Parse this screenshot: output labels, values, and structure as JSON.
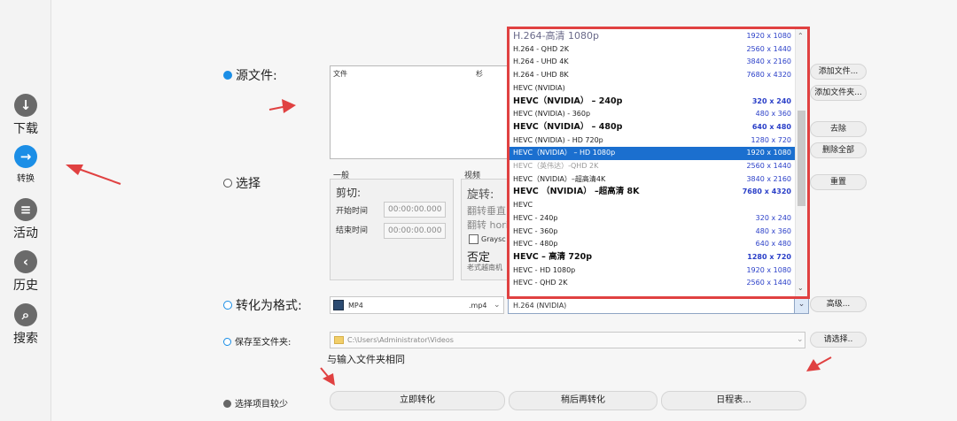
{
  "nav": {
    "items": [
      {
        "label": "下载",
        "icon": "download-icon",
        "glyph": "↓"
      },
      {
        "label": "转换",
        "icon": "convert-icon",
        "glyph": "→",
        "active": true
      },
      {
        "label": "活动",
        "icon": "list-icon",
        "glyph": "≡"
      },
      {
        "label": "历史",
        "icon": "back-icon",
        "glyph": "‹"
      },
      {
        "label": "搜索",
        "icon": "search-icon",
        "glyph": "⌕"
      }
    ]
  },
  "source": {
    "label": "源文件:",
    "file_col": "文件",
    "col2_fragment": "杉"
  },
  "side_buttons": {
    "add_file": "添加文件...",
    "add_folder": "添加文件夹...",
    "remove": "去除",
    "remove_all": "删除全部",
    "reset": "重置"
  },
  "select": {
    "label": "选择",
    "general_title": "一般",
    "cut_title": "剪切:",
    "start_label": "开始时间",
    "start_value": "00:00:00.000",
    "end_label": "结束时间",
    "end_value": "00:00:00.000",
    "video_title": "视频",
    "rotate_title": "旋转:",
    "flip_vertical": "翻转垂直",
    "flip_horizontal": "翻转 hori",
    "grayscale": "Graysc",
    "deny_title": "否定",
    "old_tv": "老式越南机"
  },
  "format": {
    "label": "转化为格式:",
    "container": "MP4",
    "extension": ".mp4",
    "codec": "H.264 (NVIDIA)",
    "advanced_button": "高级..."
  },
  "save": {
    "label": "保存至文件夹:",
    "path": "C:\\Users\\Administrator\\Videos",
    "choose_button": "请选择..",
    "same_folder": "与输入文件夹相同"
  },
  "footer": {
    "fewer_options": "选择项目较少",
    "convert_now": "立即转化",
    "convert_later": "稍后再转化",
    "schedule": "日程表..."
  },
  "dropdown": {
    "items": [
      {
        "name": "H.264-高清 1080p",
        "res": "1920 x 1080",
        "style": "first"
      },
      {
        "name": "H.264 - QHD 2K",
        "res": "2560 x 1440"
      },
      {
        "name": "H.264 - UHD 4K",
        "res": "3840 x 2160"
      },
      {
        "name": "H.264 - UHD 8K",
        "res": "7680 x 4320"
      },
      {
        "name": "HEVC (NVIDIA)",
        "res": ""
      },
      {
        "name": "HEVC（NVIDIA） – 240p",
        "res": "320 x 240",
        "style": "bold"
      },
      {
        "name": "HEVC (NVIDIA) - 360p",
        "res": "480 x 360"
      },
      {
        "name": "HEVC（NVIDIA） – 480p",
        "res": "640 x 480",
        "style": "bold"
      },
      {
        "name": "HEVC (NVIDIA) - HD 720p",
        "res": "1280 x 720"
      },
      {
        "name": "HEVC（NVIDIA） – HD 1080p",
        "res": "1920 x 1080",
        "style": "sel"
      },
      {
        "name": "HEVC（英伟达）-QHD 2K",
        "res": "2560 x 1440",
        "style": "grey"
      },
      {
        "name": "HEVC（NVIDIA）–超高清4K",
        "res": "3840 x 2160"
      },
      {
        "name": "HEVC （NVIDIA） –超高清 8K",
        "res": "7680 x 4320",
        "style": "bold"
      },
      {
        "name": "HEVC",
        "res": ""
      },
      {
        "name": "HEVC - 240p",
        "res": "320 x 240"
      },
      {
        "name": "HEVC - 360p",
        "res": "480 x 360"
      },
      {
        "name": "HEVC - 480p",
        "res": "640 x 480"
      },
      {
        "name": "HEVC – 高清 720p",
        "res": "1280 x 720",
        "style": "bold"
      },
      {
        "name": "HEVC - HD 1080p",
        "res": "1920 x 1080"
      },
      {
        "name": "HEVC - QHD 2K",
        "res": "2560 x 1440"
      }
    ]
  },
  "colors": {
    "accent": "#1b8ee6",
    "annotation_red": "#e04141",
    "selection": "#1b6fcf",
    "resolution_text": "#2a3fc8"
  }
}
